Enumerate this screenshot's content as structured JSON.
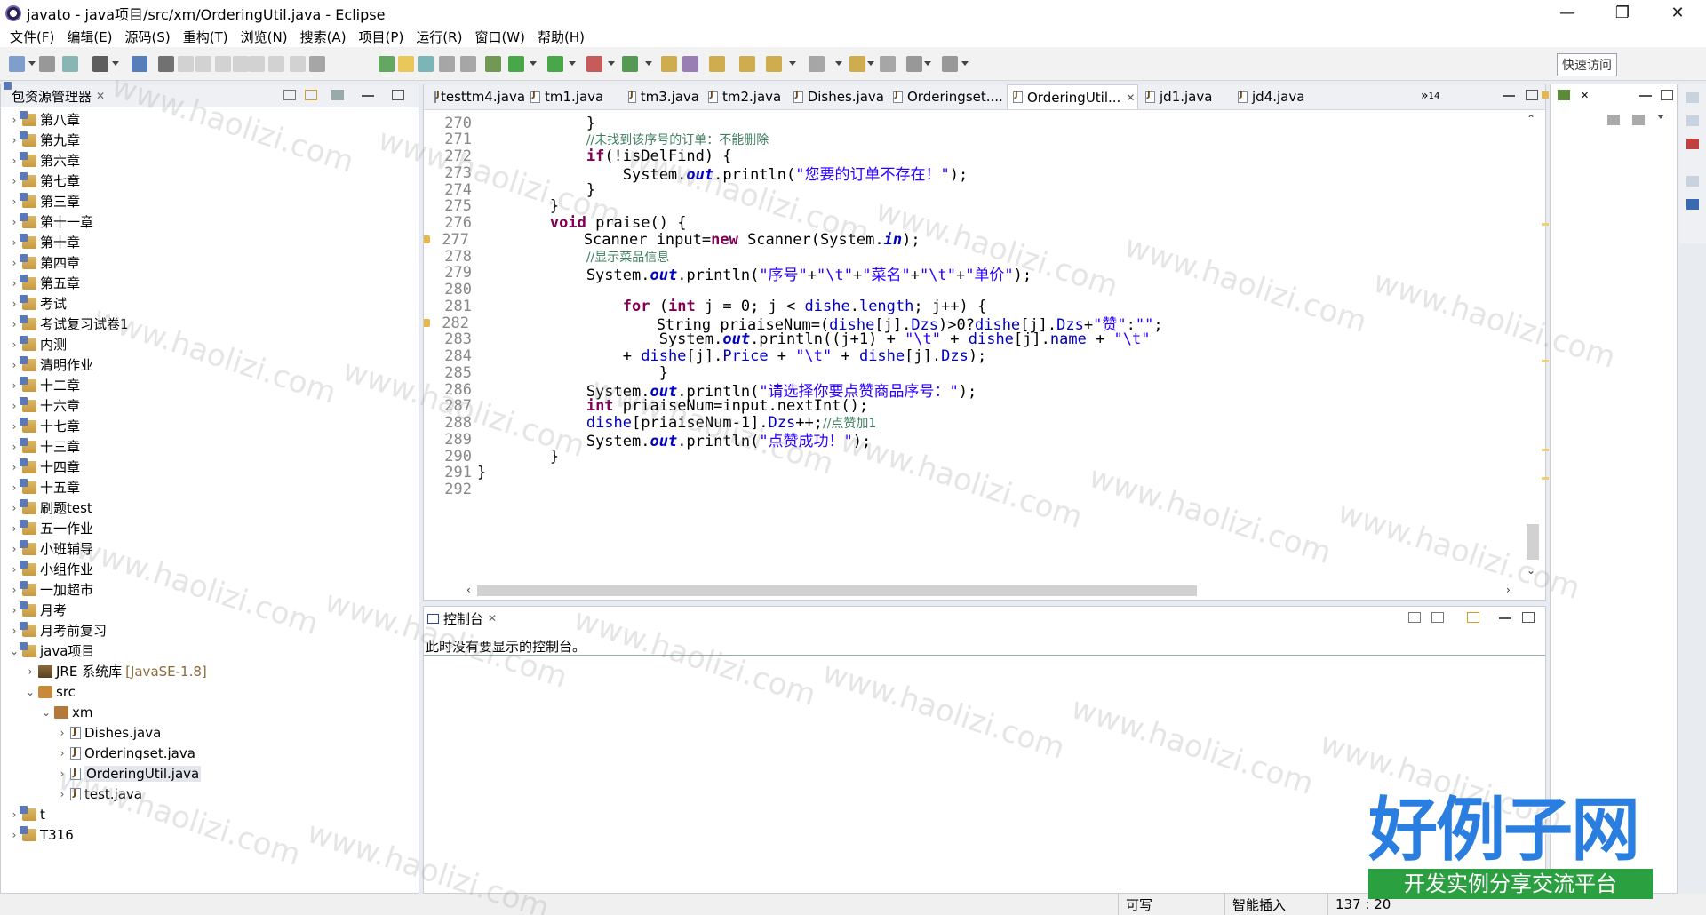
{
  "window": {
    "title": "javato - java项目/src/xm/OrderingUtil.java - Eclipse",
    "minimize_glyph": "—",
    "restore_glyph": "❐",
    "close_glyph": "✕"
  },
  "menu": [
    "文件(F)",
    "编辑(E)",
    "源码(S)",
    "重构(T)",
    "浏览(N)",
    "搜索(A)",
    "项目(P)",
    "运行(R)",
    "窗口(W)",
    "帮助(H)"
  ],
  "toolbar": {
    "quick_access": "快速访问"
  },
  "package_explorer": {
    "title": "包资源管理器",
    "close_glyph": "✕",
    "tree": [
      {
        "label": "第八章",
        "indent": 0,
        "twisty": "›",
        "icon": "folder"
      },
      {
        "label": "第九章",
        "indent": 0,
        "twisty": "›",
        "icon": "folder"
      },
      {
        "label": "第六章",
        "indent": 0,
        "twisty": "›",
        "icon": "folder"
      },
      {
        "label": "第七章",
        "indent": 0,
        "twisty": "›",
        "icon": "folder"
      },
      {
        "label": "第三章",
        "indent": 0,
        "twisty": "›",
        "icon": "folder"
      },
      {
        "label": "第十一章",
        "indent": 0,
        "twisty": "›",
        "icon": "folder"
      },
      {
        "label": "第十章",
        "indent": 0,
        "twisty": "›",
        "icon": "folder"
      },
      {
        "label": "第四章",
        "indent": 0,
        "twisty": "›",
        "icon": "folder"
      },
      {
        "label": "第五章",
        "indent": 0,
        "twisty": "›",
        "icon": "folder"
      },
      {
        "label": "考试",
        "indent": 0,
        "twisty": "›",
        "icon": "folder"
      },
      {
        "label": "考试复习试卷1",
        "indent": 0,
        "twisty": "›",
        "icon": "folder"
      },
      {
        "label": "内测",
        "indent": 0,
        "twisty": "›",
        "icon": "folder"
      },
      {
        "label": "清明作业",
        "indent": 0,
        "twisty": "›",
        "icon": "folder"
      },
      {
        "label": "十二章",
        "indent": 0,
        "twisty": "›",
        "icon": "folder"
      },
      {
        "label": "十六章",
        "indent": 0,
        "twisty": "›",
        "icon": "folder"
      },
      {
        "label": "十七章",
        "indent": 0,
        "twisty": "›",
        "icon": "folder"
      },
      {
        "label": "十三章",
        "indent": 0,
        "twisty": "›",
        "icon": "folder"
      },
      {
        "label": "十四章",
        "indent": 0,
        "twisty": "›",
        "icon": "folder"
      },
      {
        "label": "十五章",
        "indent": 0,
        "twisty": "›",
        "icon": "folder"
      },
      {
        "label": "刷题test",
        "indent": 0,
        "twisty": "›",
        "icon": "folder"
      },
      {
        "label": "五一作业",
        "indent": 0,
        "twisty": "›",
        "icon": "folder"
      },
      {
        "label": "小班辅导",
        "indent": 0,
        "twisty": "›",
        "icon": "folder"
      },
      {
        "label": "小组作业",
        "indent": 0,
        "twisty": "›",
        "icon": "folder"
      },
      {
        "label": "一加超市",
        "indent": 0,
        "twisty": "›",
        "icon": "folder"
      },
      {
        "label": "月考",
        "indent": 0,
        "twisty": "›",
        "icon": "folder"
      },
      {
        "label": "月考前复习",
        "indent": 0,
        "twisty": "›",
        "icon": "folder"
      },
      {
        "label": "java项目",
        "indent": 0,
        "twisty": "⌄",
        "icon": "folder"
      },
      {
        "label": "JRE 系统库",
        "tag": "[JavaSE-1.8]",
        "indent": 1,
        "twisty": "›",
        "icon": "jre"
      },
      {
        "label": "src",
        "indent": 1,
        "twisty": "⌄",
        "icon": "src"
      },
      {
        "label": "xm",
        "indent": 2,
        "twisty": "⌄",
        "icon": "pkg"
      },
      {
        "label": "Dishes.java",
        "indent": 3,
        "twisty": "›",
        "icon": "java"
      },
      {
        "label": "Orderingset.java",
        "indent": 3,
        "twisty": "›",
        "icon": "java"
      },
      {
        "label": "OrderingUtil.java",
        "indent": 3,
        "twisty": "›",
        "icon": "java",
        "selected": true
      },
      {
        "label": "test.java",
        "indent": 3,
        "twisty": "›",
        "icon": "java"
      },
      {
        "label": "t",
        "indent": 0,
        "twisty": "›",
        "icon": "folder"
      },
      {
        "label": "T316",
        "indent": 0,
        "twisty": "›",
        "icon": "folder"
      }
    ]
  },
  "editor": {
    "tabs": [
      {
        "label": "testtm4.java"
      },
      {
        "label": "tm1.java"
      },
      {
        "label": "tm3.java"
      },
      {
        "label": "tm2.java"
      },
      {
        "label": "Dishes.java"
      },
      {
        "label": "Orderingset...."
      },
      {
        "label": "OrderingUtil...",
        "active": true,
        "close": "✕"
      },
      {
        "label": "jd1.java"
      },
      {
        "label": "jd4.java"
      }
    ],
    "overflow": "»",
    "overflow_count": "14",
    "lines": [
      {
        "n": "270",
        "code": "            }"
      },
      {
        "n": "271",
        "code": "            //未找到该序号的订单：不能删除"
      },
      {
        "n": "272",
        "code": "            if(!isDelFind) {"
      },
      {
        "n": "273",
        "code": "                System.out.println(\"您要的订单不存在！\");"
      },
      {
        "n": "274",
        "code": "            }"
      },
      {
        "n": "275",
        "code": "        }"
      },
      {
        "n": "276",
        "code": "        void praise() {"
      },
      {
        "n": "277",
        "code": "            Scanner input=new Scanner(System.in);",
        "warn": true
      },
      {
        "n": "278",
        "code": "            //显示菜品信息"
      },
      {
        "n": "279",
        "code": "            System.out.println(\"序号\"+\"\\t\"+\"菜名\"+\"\\t\"+\"单价\");"
      },
      {
        "n": "280",
        "code": ""
      },
      {
        "n": "281",
        "code": "                for (int j = 0; j < dishe.length; j++) {"
      },
      {
        "n": "282",
        "code": "                    String priaiseNum=(dishe[j].Dzs)>0?dishe[j].Dzs+\"赞\":\"\";",
        "warn": true
      },
      {
        "n": "283",
        "code": "                    System.out.println((j+1) + \"\\t\" + dishe[j].name + \"\\t\""
      },
      {
        "n": "284",
        "code": "                + dishe[j].Price + \"\\t\" + dishe[j].Dzs);"
      },
      {
        "n": "285",
        "code": "                    }"
      },
      {
        "n": "286",
        "code": "            System.out.println(\"请选择你要点赞商品序号：\");"
      },
      {
        "n": "287",
        "code": "            int priaiseNum=input.nextInt();"
      },
      {
        "n": "288",
        "code": "            dishe[priaiseNum-1].Dzs++;//点赞加1"
      },
      {
        "n": "289",
        "code": "            System.out.println(\"点赞成功！\");"
      },
      {
        "n": "290",
        "code": "        }"
      },
      {
        "n": "291",
        "code": "}"
      },
      {
        "n": "292",
        "code": ""
      }
    ]
  },
  "console": {
    "title": "控制台",
    "close_glyph": "✕",
    "message": "此时没有要显示的控制台。"
  },
  "status": {
    "writable": "可写",
    "insert_mode": "智能插入",
    "position": "137 : 20"
  },
  "watermark": {
    "brand": "好例子网",
    "slogan": "开发实例分享交流平台",
    "overlay": "www.haolizi.com"
  },
  "colors": {
    "keyword": "#7f0055",
    "string": "#2a00ff",
    "comment": "#3f7f5f",
    "field": "#0000c0",
    "brand_blue": "#2a7ee0",
    "brand_green": "#2aa040"
  }
}
